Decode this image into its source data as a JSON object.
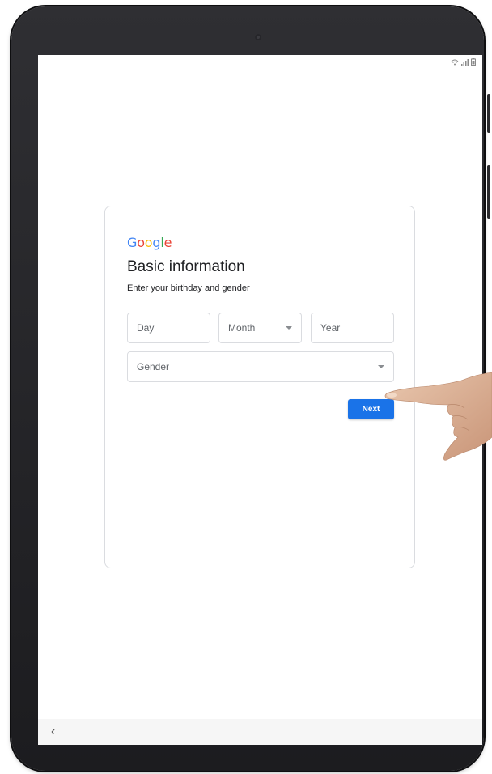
{
  "brand": {
    "logo_letters": [
      "G",
      "o",
      "o",
      "g",
      "l",
      "e"
    ],
    "logo_colors": [
      "#4285F4",
      "#EA4335",
      "#FBBC05",
      "#4285F4",
      "#34A853",
      "#EA4335"
    ]
  },
  "form": {
    "title": "Basic information",
    "subtitle": "Enter your birthday and gender",
    "day_placeholder": "Day",
    "month_label": "Month",
    "year_placeholder": "Year",
    "gender_label": "Gender",
    "next_label": "Next"
  },
  "nav": {
    "back_symbol": "‹"
  },
  "colors": {
    "accent": "#1a73e8",
    "border": "#dadce0"
  },
  "icons": [
    "wifi-icon",
    "signal-icon",
    "battery-icon",
    "chevron-down-icon",
    "back-icon",
    "camera-icon"
  ]
}
